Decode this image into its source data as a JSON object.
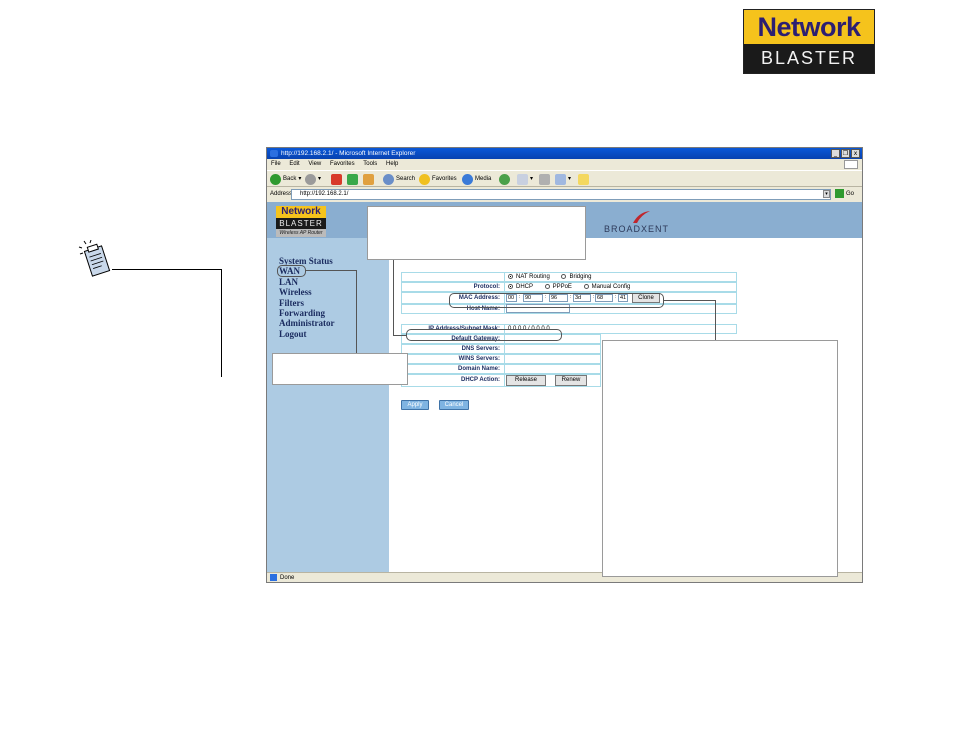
{
  "logo": {
    "line1": "Network",
    "line2": "BLASTER"
  },
  "browser": {
    "title": "http://192.168.2.1/ - Microsoft Internet Explorer",
    "title_buttons": [
      "_",
      "❐",
      "x"
    ],
    "menu": [
      "File",
      "Edit",
      "View",
      "Favorites",
      "Tools",
      "Help"
    ],
    "toolbar": {
      "back": "Back",
      "search": "Search",
      "favorites": "Favorites",
      "media": "Media"
    },
    "address_label": "Address",
    "address_value": "http://192.168.2.1/",
    "go_label": "Go",
    "status": "Done"
  },
  "router_page": {
    "logo_top": "Network",
    "logo_mid": "BLASTER",
    "logo_bottom": "Wireless AP Router",
    "brand": "BROADXENT",
    "nav": [
      "System Status",
      "WAN",
      "LAN",
      "Wireless",
      "Filters",
      "Forwarding",
      "Administrator",
      "Logout"
    ],
    "form": {
      "routing_options": [
        "NAT Routing",
        "Bridging"
      ],
      "protocol_label": "Protocol:",
      "protocol_options": [
        "DHCP",
        "PPPoE",
        "Manual Config"
      ],
      "mac_label": "MAC Address:",
      "mac_parts": [
        "00",
        "90",
        "96",
        "3d",
        "68",
        "41"
      ],
      "clone_label": "Clone",
      "host_label": "Host Name:",
      "ip_label": "IP Address/Subnet Mask:",
      "ip_value": "0.0.0.0 / 0.0.0.0",
      "gateway_label": "Default Gateway:",
      "dns_label": "DNS Servers:",
      "wins_label": "WINS Servers:",
      "domain_label": "Domain Name:",
      "dhcp_action_label": "DHCP Action:",
      "release_label": "Release",
      "renew_label": "Renew",
      "apply_label": "Apply",
      "cancel_label": "Cancel"
    }
  }
}
